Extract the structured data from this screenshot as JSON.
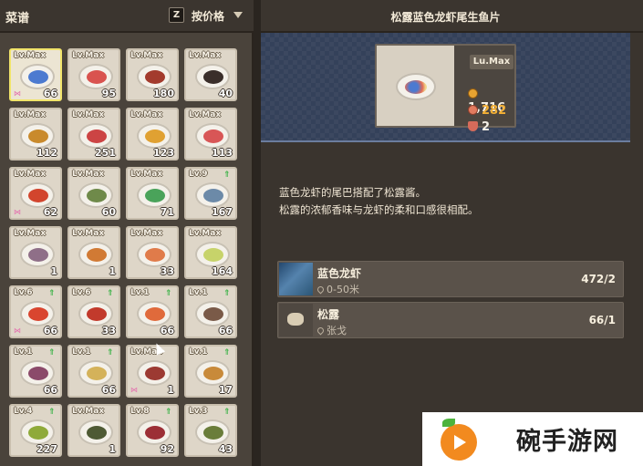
{
  "left_panel": {
    "title": "菜谱",
    "sort_key": "Z",
    "sort_label": "按价格"
  },
  "recipes": [
    {
      "level": "Lv.Max",
      "count": "66",
      "upgrade": false,
      "bow": true,
      "selected": true,
      "food": "#4c7ad0"
    },
    {
      "level": "Lv.Max",
      "count": "95",
      "upgrade": false,
      "bow": false,
      "selected": false,
      "food": "#d9534f"
    },
    {
      "level": "Lv.Max",
      "count": "180",
      "upgrade": false,
      "bow": false,
      "selected": false,
      "food": "#a33b2d"
    },
    {
      "level": "Lv.Max",
      "count": "40",
      "upgrade": false,
      "bow": false,
      "selected": false,
      "food": "#3a2e2a"
    },
    {
      "level": "Lv.Max",
      "count": "112",
      "upgrade": false,
      "bow": false,
      "selected": false,
      "food": "#c98a2c"
    },
    {
      "level": "Lv.Max",
      "count": "251",
      "upgrade": false,
      "bow": false,
      "selected": false,
      "food": "#c44"
    },
    {
      "level": "Lv.Max",
      "count": "123",
      "upgrade": false,
      "bow": false,
      "selected": false,
      "food": "#e0a132"
    },
    {
      "level": "Lv.Max",
      "count": "113",
      "upgrade": false,
      "bow": false,
      "selected": false,
      "food": "#d85656"
    },
    {
      "level": "Lv.Max",
      "count": "62",
      "upgrade": false,
      "bow": true,
      "selected": false,
      "food": "#d2452d"
    },
    {
      "level": "Lv.Max",
      "count": "60",
      "upgrade": false,
      "bow": false,
      "selected": false,
      "food": "#6f8a4a"
    },
    {
      "level": "Lv.Max",
      "count": "71",
      "upgrade": false,
      "bow": false,
      "selected": false,
      "food": "#4aa35a"
    },
    {
      "level": "Lv.9",
      "count": "167",
      "upgrade": true,
      "bow": false,
      "selected": false,
      "food": "#6c8aa8"
    },
    {
      "level": "Lv.Max",
      "count": "1",
      "upgrade": false,
      "bow": false,
      "selected": false,
      "food": "#8f6f88"
    },
    {
      "level": "Lv.Max",
      "count": "1",
      "upgrade": false,
      "bow": false,
      "selected": false,
      "food": "#d17a34"
    },
    {
      "level": "Lv.Max",
      "count": "33",
      "upgrade": false,
      "bow": false,
      "selected": false,
      "food": "#e07b4a"
    },
    {
      "level": "Lv.Max",
      "count": "164",
      "upgrade": false,
      "bow": false,
      "selected": false,
      "food": "#c7d36a"
    },
    {
      "level": "Lv.6",
      "count": "66",
      "upgrade": true,
      "bow": true,
      "selected": false,
      "food": "#d9452f"
    },
    {
      "level": "Lv.6",
      "count": "33",
      "upgrade": true,
      "bow": false,
      "selected": false,
      "food": "#c23a2c"
    },
    {
      "level": "Lv.1",
      "count": "66",
      "upgrade": true,
      "bow": false,
      "selected": false,
      "food": "#e06a3b"
    },
    {
      "level": "Lv.1",
      "count": "66",
      "upgrade": true,
      "bow": false,
      "selected": false,
      "food": "#7a5a48"
    },
    {
      "level": "Lv.1",
      "count": "66",
      "upgrade": true,
      "bow": false,
      "selected": false,
      "food": "#8b4a6a"
    },
    {
      "level": "Lv.1",
      "count": "66",
      "upgrade": true,
      "bow": false,
      "selected": false,
      "food": "#d4b25a"
    },
    {
      "level": "Lv.Max",
      "count": "1",
      "upgrade": false,
      "bow": true,
      "selected": false,
      "food": "#9c3a32"
    },
    {
      "level": "Lv.1",
      "count": "17",
      "upgrade": true,
      "bow": false,
      "selected": false,
      "food": "#c88a3a"
    },
    {
      "level": "Lv.4",
      "count": "227",
      "upgrade": true,
      "bow": false,
      "selected": false,
      "food": "#8faa3a"
    },
    {
      "level": "Lv.Max",
      "count": "1",
      "upgrade": false,
      "bow": false,
      "selected": false,
      "food": "#4e5a34"
    },
    {
      "level": "Lv.8",
      "count": "92",
      "upgrade": true,
      "bow": false,
      "selected": false,
      "food": "#9c2f36"
    },
    {
      "level": "Lv.3",
      "count": "43",
      "upgrade": true,
      "bow": false,
      "selected": false,
      "food": "#6a7d3a"
    }
  ],
  "detail": {
    "title": "松露蓝色龙虾尾生鱼片",
    "level": "Lu.Max",
    "price": "1,716",
    "bonus": "282",
    "bowls": "2",
    "description_line1": "蓝色龙虾的尾巴搭配了松露酱。",
    "description_line2": "松露的浓郁香味与龙虾的柔和口感很相配。",
    "ingredients": [
      {
        "name": "蓝色龙虾",
        "location": "0-50米",
        "count": "472/2"
      },
      {
        "name": "松露",
        "location": "张戈",
        "count": "66/1"
      }
    ]
  },
  "watermark": {
    "text": "碗手游网"
  },
  "colors": {
    "selected_border": "#f1e46a",
    "upgrade": "#3fb34a",
    "bonus": "#f4b035",
    "hero_bg": "#34415a"
  }
}
